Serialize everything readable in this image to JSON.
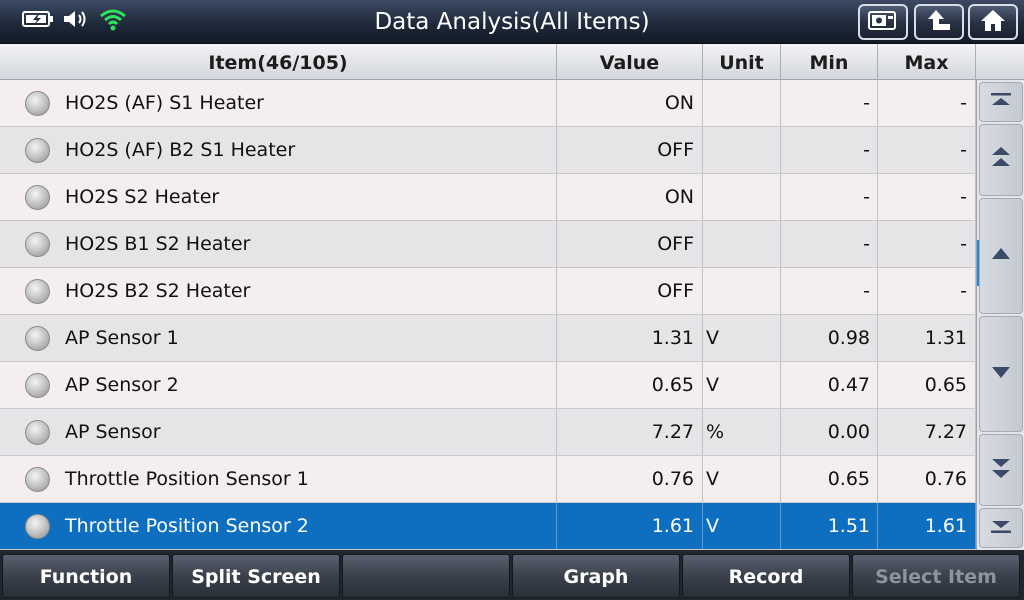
{
  "header": {
    "title": "Data Analysis(All Items)",
    "icons": [
      "battery-charging-icon",
      "speaker-icon",
      "wifi-icon"
    ],
    "buttons": [
      "screenshot-icon",
      "back-icon",
      "home-icon"
    ]
  },
  "table": {
    "columns": {
      "item": "Item(46/105)",
      "value": "Value",
      "unit": "Unit",
      "min": "Min",
      "max": "Max"
    },
    "rows": [
      {
        "item": "HO2S (AF) S1 Heater",
        "value": "ON",
        "unit": "",
        "min": "-",
        "max": "-"
      },
      {
        "item": "HO2S (AF) B2 S1 Heater",
        "value": "OFF",
        "unit": "",
        "min": "-",
        "max": "-"
      },
      {
        "item": "HO2S S2 Heater",
        "value": "ON",
        "unit": "",
        "min": "-",
        "max": "-"
      },
      {
        "item": "HO2S B1 S2 Heater",
        "value": "OFF",
        "unit": "",
        "min": "-",
        "max": "-"
      },
      {
        "item": "HO2S B2 S2 Heater",
        "value": "OFF",
        "unit": "",
        "min": "-",
        "max": "-"
      },
      {
        "item": "AP Sensor 1",
        "value": "1.31",
        "unit": "V",
        "min": "0.98",
        "max": "1.31"
      },
      {
        "item": "AP Sensor 2",
        "value": "0.65",
        "unit": "V",
        "min": "0.47",
        "max": "0.65"
      },
      {
        "item": "AP Sensor",
        "value": "7.27",
        "unit": "%",
        "min": "0.00",
        "max": "7.27"
      },
      {
        "item": "Throttle Position Sensor 1",
        "value": "0.76",
        "unit": "V",
        "min": "0.65",
        "max": "0.76"
      },
      {
        "item": "Throttle Position Sensor 2",
        "value": "1.61",
        "unit": "V",
        "min": "1.51",
        "max": "1.61"
      }
    ],
    "selected_row": 9,
    "selected_color": "#0e6fc1"
  },
  "scrollbar": {
    "buttons": [
      "scroll-top-icon",
      "page-up-icon",
      "line-up-icon",
      "line-down-icon",
      "page-down-icon",
      "scroll-bottom-icon"
    ]
  },
  "toolbar": {
    "function": "Function",
    "split_screen": "Split Screen",
    "empty": "",
    "graph": "Graph",
    "record": "Record",
    "select_item": "Select Item"
  }
}
